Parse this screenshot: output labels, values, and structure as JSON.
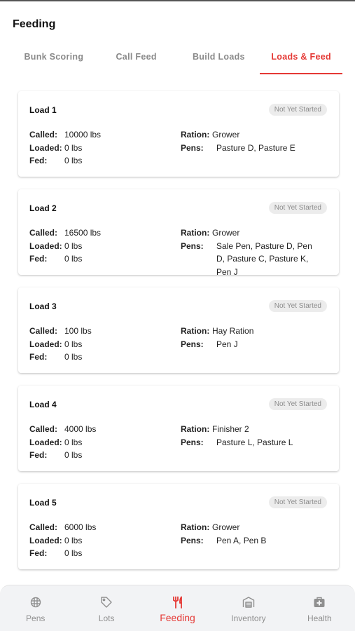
{
  "header": {
    "title": "Feeding"
  },
  "tabs": [
    {
      "label": "Bunk Scoring"
    },
    {
      "label": "Call Feed"
    },
    {
      "label": "Build Loads"
    },
    {
      "label": "Loads & Feed"
    }
  ],
  "field_labels": {
    "called": "Called:",
    "loaded": "Loaded:",
    "fed": "Fed:",
    "ration": "Ration:",
    "pens": "Pens:"
  },
  "loads": [
    {
      "title": "Load 1",
      "status": "Not Yet Started",
      "called": "10000 lbs",
      "loaded": "0 lbs",
      "fed": "0 lbs",
      "ration": "Grower",
      "pens": "Pasture D, Pasture E"
    },
    {
      "title": "Load 2",
      "status": "Not Yet Started",
      "called": "16500 lbs",
      "loaded": "0 lbs",
      "fed": "0 lbs",
      "ration": "Grower",
      "pens": "Sale Pen, Pasture D, Pen D, Pasture C, Pasture K, Pen J"
    },
    {
      "title": "Load 3",
      "status": "Not Yet Started",
      "called": "100 lbs",
      "loaded": "0 lbs",
      "fed": "0 lbs",
      "ration": "Hay Ration",
      "pens": "Pen J"
    },
    {
      "title": "Load 4",
      "status": "Not Yet Started",
      "called": "4000 lbs",
      "loaded": "0 lbs",
      "fed": "0 lbs",
      "ration": "Finisher 2",
      "pens": "Pasture L, Pasture L"
    },
    {
      "title": "Load 5",
      "status": "Not Yet Started",
      "called": "6000 lbs",
      "loaded": "0 lbs",
      "fed": "0 lbs",
      "ration": "Grower",
      "pens": "Pen A, Pen B"
    }
  ],
  "bottom_nav": [
    {
      "label": "Pens",
      "icon": "pens-icon"
    },
    {
      "label": "Lots",
      "icon": "tag-icon"
    },
    {
      "label": "Feeding",
      "icon": "fork-knife-icon"
    },
    {
      "label": "Inventory",
      "icon": "warehouse-icon"
    },
    {
      "label": "Health",
      "icon": "medical-bag-icon"
    }
  ],
  "colors": {
    "accent": "#e53935",
    "inactive": "#8f8f8f",
    "badge_bg": "#ececec"
  },
  "active_tab_index": 3,
  "active_nav_index": 2
}
